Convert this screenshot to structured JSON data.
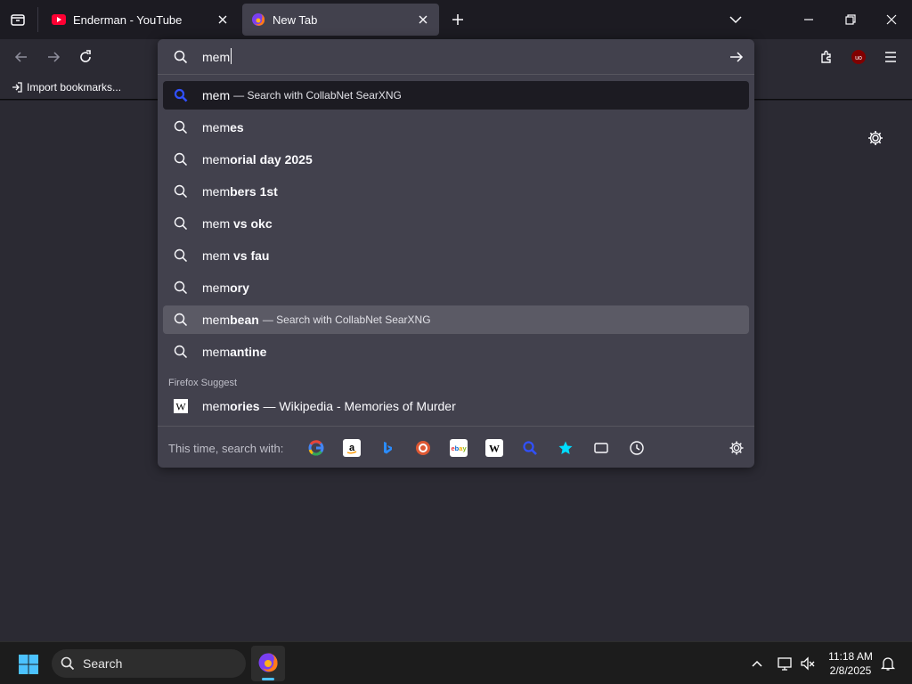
{
  "tabs": [
    {
      "title": "Enderman - YouTube",
      "favicon": "youtube-icon",
      "active": false
    },
    {
      "title": "New Tab",
      "favicon": "firefox-icon",
      "active": true
    }
  ],
  "urlbar": {
    "value": "mem"
  },
  "bookmarks": {
    "import_label": "Import bookmarks..."
  },
  "results": [
    {
      "typed": "mem",
      "rest": "",
      "action": "— Search with CollabNet SearXNG",
      "state": "selected",
      "icon": "searxng-icon"
    },
    {
      "typed": "mem",
      "rest": "es",
      "action": "",
      "state": "",
      "icon": "search-icon"
    },
    {
      "typed": "mem",
      "rest": "orial day 2025",
      "action": "",
      "state": "",
      "icon": "search-icon"
    },
    {
      "typed": "mem",
      "rest": "bers 1st",
      "action": "",
      "state": "",
      "icon": "search-icon"
    },
    {
      "typed": "mem",
      "rest": " vs okc",
      "action": "",
      "state": "",
      "icon": "search-icon"
    },
    {
      "typed": "mem",
      "rest": " vs fau",
      "action": "",
      "state": "",
      "icon": "search-icon"
    },
    {
      "typed": "mem",
      "rest": "ory",
      "action": "",
      "state": "",
      "icon": "search-icon"
    },
    {
      "typed": "mem",
      "rest": "bean",
      "action": "— Search with CollabNet SearXNG",
      "state": "hover",
      "icon": "search-icon"
    },
    {
      "typed": "mem",
      "rest": "antine",
      "action": "",
      "state": "",
      "icon": "search-icon"
    }
  ],
  "suggest_section": {
    "label": "Firefox Suggest",
    "item": {
      "typed": "mem",
      "rest": "ories",
      "tail": " — Wikipedia - Memories of Murder",
      "icon": "wikipedia-icon"
    }
  },
  "oneoff": {
    "label": "This time, search with:",
    "engines": [
      "google-icon",
      "amazon-icon",
      "bing-icon",
      "duckduckgo-icon",
      "ebay-icon",
      "wikipedia-icon",
      "searxng-icon",
      "bookmarks-icon",
      "tabs-icon",
      "history-icon"
    ]
  },
  "taskbar": {
    "search_placeholder": "Search",
    "time": "11:18 AM",
    "date": "2/8/2025"
  },
  "colors": {
    "accent": "#00ddff",
    "selected_row": "#1c1b22",
    "hover_row": "#5b5a65",
    "panel": "#42414d"
  }
}
